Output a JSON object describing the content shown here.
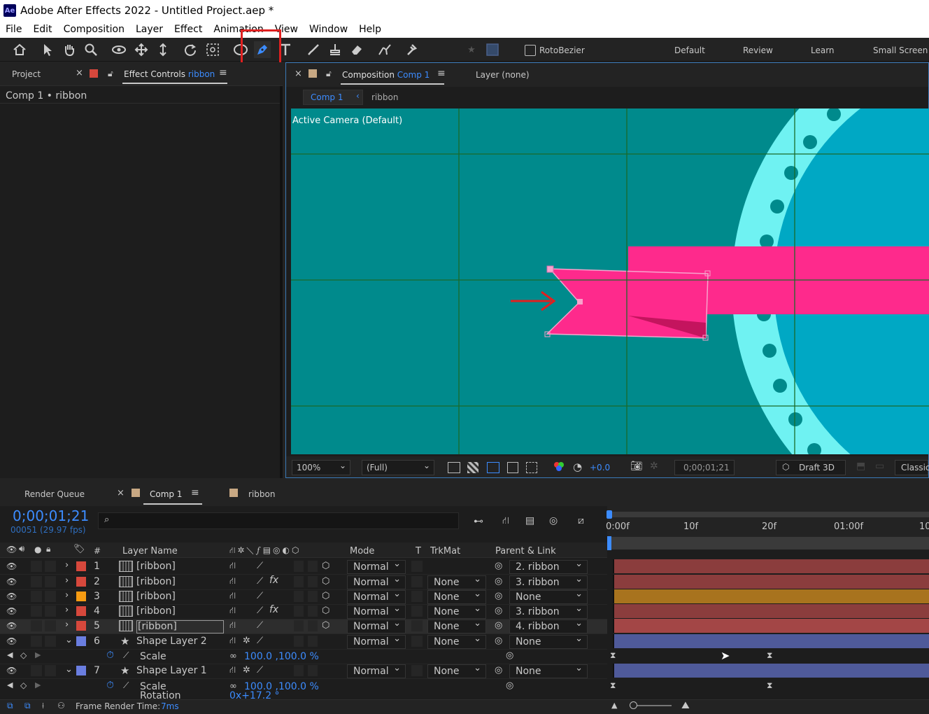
{
  "app": {
    "logo": "Ae",
    "title": "Adobe After Effects 2022 - Untitled Project.aep *"
  },
  "menu": [
    "File",
    "Edit",
    "Composition",
    "Layer",
    "Effect",
    "Animation",
    "View",
    "Window",
    "Help"
  ],
  "toolbar": {
    "tools": [
      "home-icon",
      "selection-icon",
      "hand-icon",
      "zoom-icon",
      "orbit-camera-icon",
      "pan-camera-icon",
      "dolly-camera-icon",
      "rotation-icon",
      "pan-behind-icon",
      "ellipse-icon",
      "pen-icon",
      "type-icon",
      "brush-icon",
      "clone-stamp-icon",
      "eraser-icon",
      "roto-brush-icon",
      "puppet-pin-icon"
    ],
    "rotobezier_label": "RotoBezier",
    "workspaces": [
      "Default",
      "Review",
      "Learn",
      "Small Screen"
    ]
  },
  "left_panel": {
    "project_tab": "Project",
    "effect_controls_tab": "Effect Controls",
    "effect_controls_target": "ribbon",
    "breadcrumb": "Comp 1 • ribbon"
  },
  "comp_panel": {
    "tab_label": "Composition",
    "tab_comp": "Comp 1",
    "layer_tab": "Layer (none)",
    "nav_comp": "Comp 1",
    "nav_ribbon": "ribbon",
    "camera_label": "Active Camera (Default)",
    "zoom": "100%",
    "resolution": "(Full)",
    "exposure": "+0.0",
    "timecode": "0;00;01;21",
    "renderer": "Draft 3D",
    "classic": "Classic",
    "colors": {
      "bg": "#008a8c",
      "grid": "#1a6a2a",
      "ribbon": "#fe2a8c",
      "gear_outer": "#6ff2f2",
      "gear_inner": "#00a8c4"
    }
  },
  "timeline": {
    "tabs": [
      "Render Queue",
      "Comp 1",
      "ribbon"
    ],
    "current_time": "0;00;01;21",
    "frame_info": "00051 (29.97 fps)",
    "columns": {
      "layer_name": "Layer Name",
      "mode": "Mode",
      "t": "T",
      "trkmat": "TrkMat",
      "parent": "Parent & Link"
    },
    "ruler": [
      "0:00f",
      "10f",
      "20f",
      "01:00f",
      "10"
    ],
    "layers": [
      {
        "num": "1",
        "name": "[ribbon]",
        "mode": "Normal",
        "trkmat": "",
        "parent": "2. ribbon",
        "color": "#d6483c",
        "fx": "",
        "bar": "#8b3d3d"
      },
      {
        "num": "2",
        "name": "[ribbon]",
        "mode": "Normal",
        "trkmat": "None",
        "parent": "3. ribbon",
        "color": "#d6483c",
        "fx": "fx",
        "bar": "#8b3d3d"
      },
      {
        "num": "3",
        "name": "[ribbon]",
        "mode": "Normal",
        "trkmat": "None",
        "parent": "None",
        "color": "#f59b12",
        "fx": "",
        "bar": "#a8731e"
      },
      {
        "num": "4",
        "name": "[ribbon]",
        "mode": "Normal",
        "trkmat": "None",
        "parent": "3. ribbon",
        "color": "#d6483c",
        "fx": "fx",
        "bar": "#8b3d3d"
      },
      {
        "num": "5",
        "name": "[ribbon]",
        "mode": "Normal",
        "trkmat": "None",
        "parent": "4. ribbon",
        "color": "#d6483c",
        "fx": "",
        "bar": "#a34646"
      },
      {
        "num": "6",
        "name": "Shape Layer 2",
        "mode": "Normal",
        "trkmat": "None",
        "parent": "None",
        "color": "#6a7ee0",
        "fx": "",
        "bar": "#4f5a9a"
      },
      {
        "num": "7",
        "name": "Shape Layer 1",
        "mode": "Normal",
        "trkmat": "None",
        "parent": "None",
        "color": "#6a7ee0",
        "fx": "",
        "bar": "#4f5a9a"
      }
    ],
    "props": {
      "scale_label": "Scale",
      "scale6": "100.0 ,100.0 %",
      "scale7": "100.0 ,100.0 %",
      "rotation_label": "Rotation",
      "rotation7": "0x+17.2 °"
    },
    "footer": {
      "label": "Frame Render Time:",
      "value": "7ms"
    }
  }
}
